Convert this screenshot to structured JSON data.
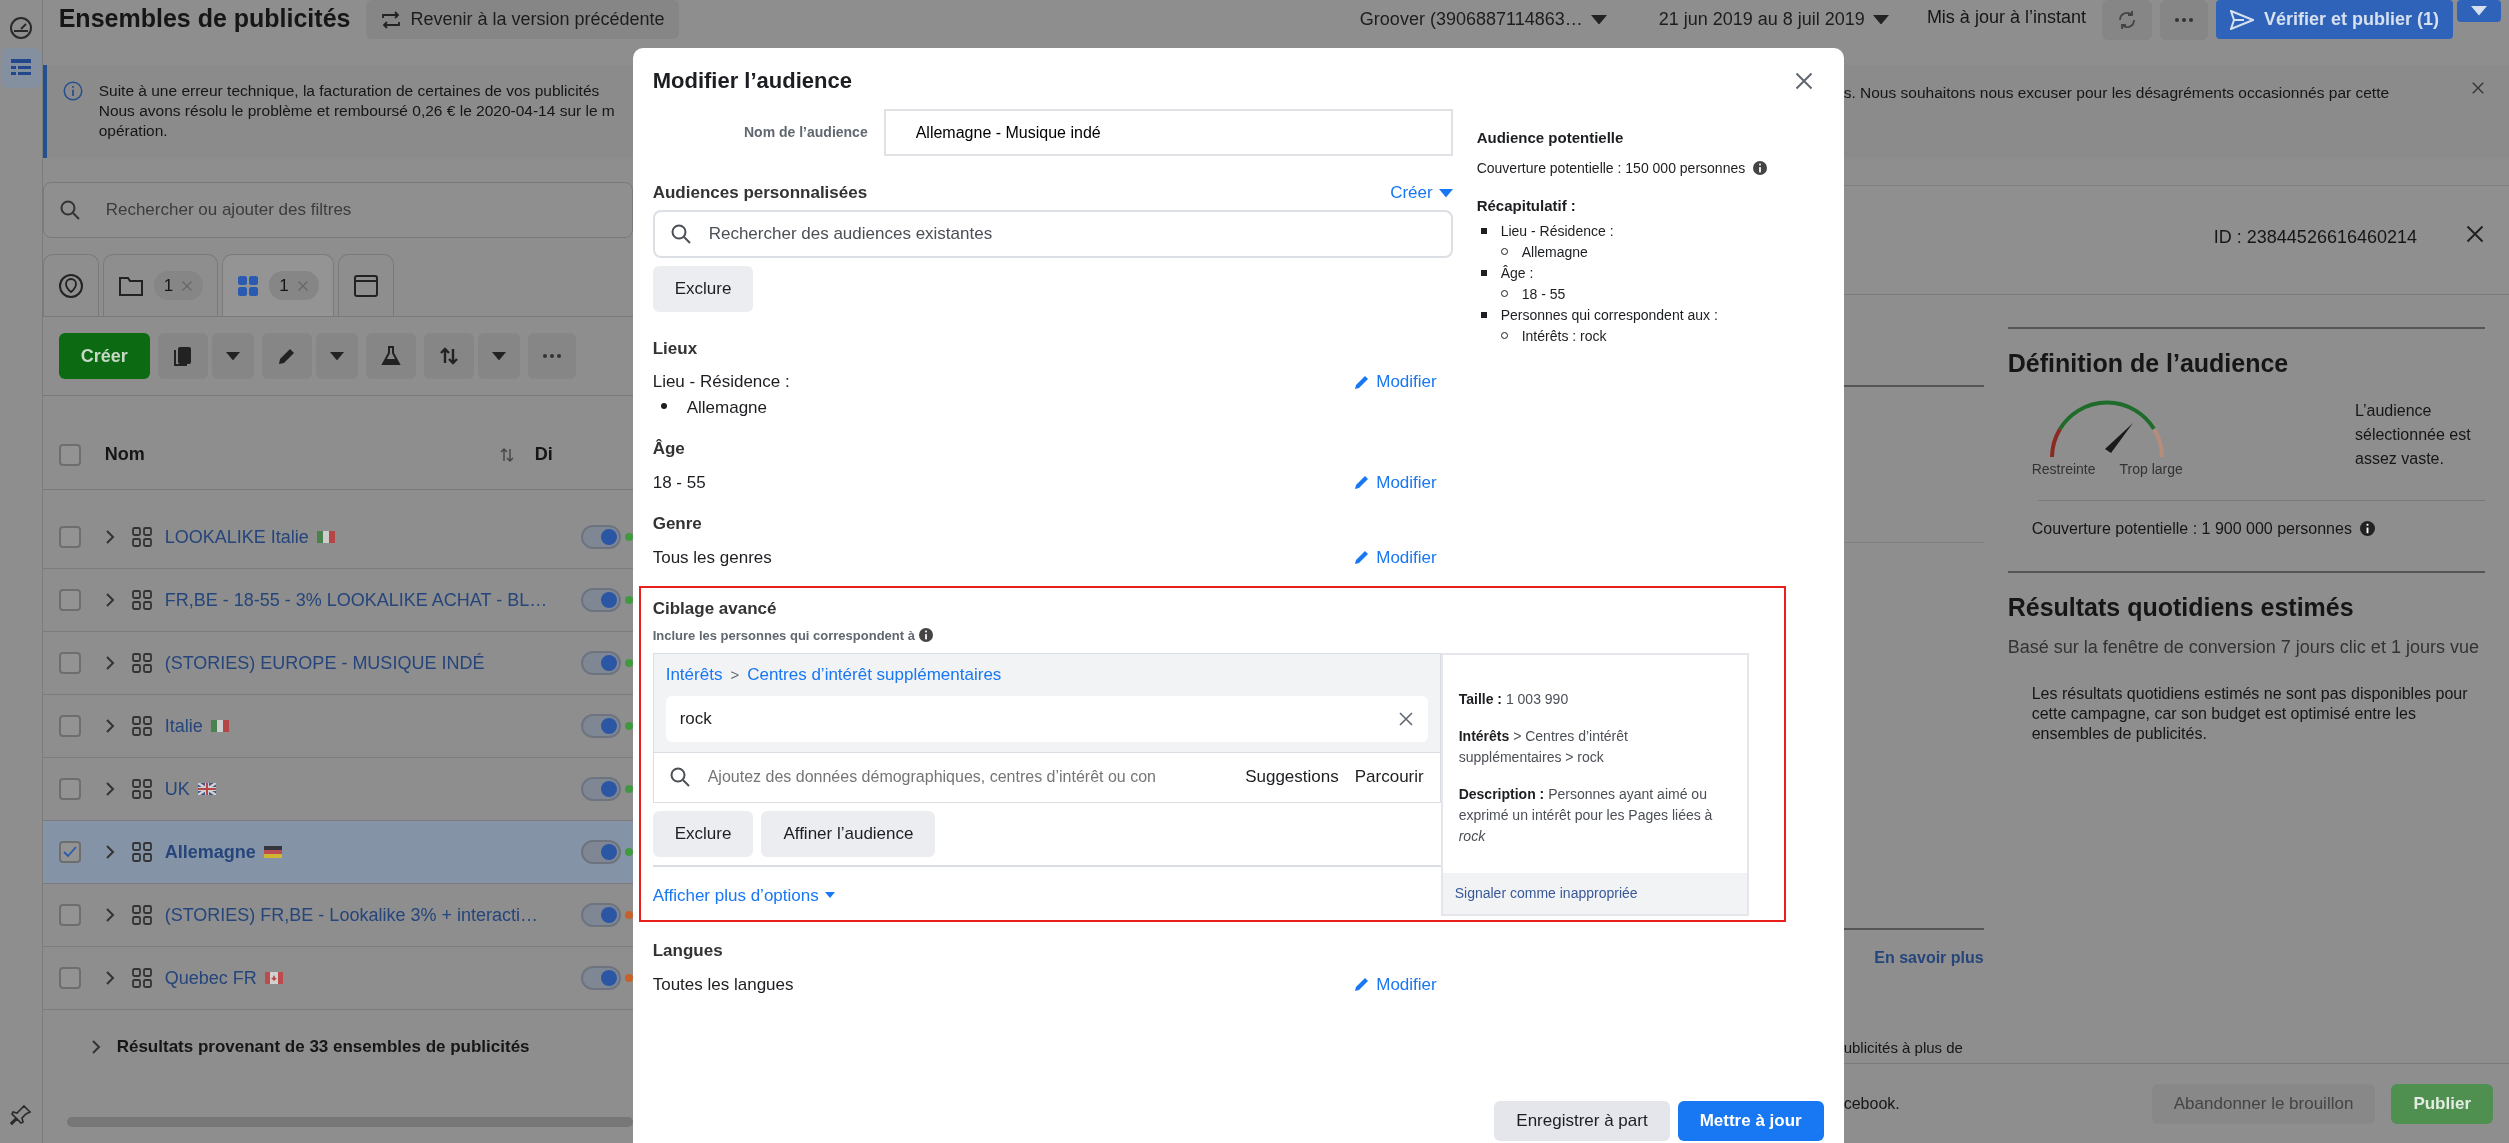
{
  "top_bar": {
    "title": "Ensembles de publicités",
    "revert_button": "Revenir à la version précédente",
    "account": "Groover (3906887114863…",
    "date_range": "21 jun 2019 au 8 juil 2019",
    "status": "Mis à jour à l’instant",
    "publish_button": "Vérifier et publier (1)"
  },
  "sidebar": {
    "items": [
      {
        "kind": "gauge",
        "selected": false
      },
      {
        "kind": "table",
        "selected": true
      },
      {
        "kind": "pin",
        "selected": false
      }
    ]
  },
  "notice": {
    "lines": [
      "Suite à une erreur technique, la facturation de certaines de vos publicités",
      "Nous avons résolu le problème et remboursé 0,26 € le 2020-04-14 sur le m",
      "opération."
    ],
    "continuation": "s. Nous souhaitons nous excuser pour les désagréments occasionnés par cette"
  },
  "filter_search": {
    "placeholder": "Rechercher ou ajouter des filtres"
  },
  "tabs": [
    {
      "kind": "pin",
      "selected": false
    },
    {
      "kind": "folder",
      "count": "1",
      "selected": false
    },
    {
      "kind": "grid",
      "count": "1",
      "selected": true
    },
    {
      "kind": "window",
      "selected": false
    }
  ],
  "toolbar": {
    "create_button": "Créer",
    "tools": [
      {
        "kind": "duplicate",
        "menu": true
      },
      {
        "kind": "edit",
        "menu": true
      },
      {
        "kind": "test",
        "menu": false
      },
      {
        "kind": "sort",
        "menu": true
      },
      {
        "kind": "more",
        "menu": false
      }
    ]
  },
  "table": {
    "select_all": {
      "checked": false
    },
    "columns": [
      "Nom",
      "Di"
    ],
    "rows": [
      {
        "name": "LOOKALIKE Italie",
        "flag": {
          "kind": "it"
        },
        "on": true,
        "selected": false,
        "color": "#3f9a3f"
      },
      {
        "name": "FR,BE - 18-55 - 3% LOOKALIKE ACHAT - BL…",
        "on": true,
        "selected": false,
        "color": "#3f9a3f"
      },
      {
        "name": "(STORIES) EUROPE - MUSIQUE INDÉ",
        "on": true,
        "selected": false,
        "color": "#3f9a3f"
      },
      {
        "name": "Italie",
        "flag": {
          "kind": "it"
        },
        "on": true,
        "selected": false,
        "color": "#3f9a3f"
      },
      {
        "name": "UK",
        "flag": {
          "kind": "gb"
        },
        "on": true,
        "selected": false,
        "color": "#3f9a3f"
      },
      {
        "name": "Allemagne",
        "flag": {
          "kind": "de"
        },
        "on": true,
        "selected": true,
        "color": "#3f9a3f"
      },
      {
        "name": "(STORIES) FR,BE - Lookalike 3% + interacti…",
        "on": true,
        "selected": false,
        "color": "#c8602a"
      },
      {
        "name": "Quebec FR",
        "flag": {
          "kind": "ca"
        },
        "on": true,
        "selected": false,
        "color": "#c8602a"
      }
    ],
    "summary": "Résultats provenant de 33 ensembles de publicités"
  },
  "modal": {
    "title": "Modifier l’audience",
    "name_label": "Nom de l’audience",
    "name_value": "Allemagne - Musique indé",
    "custom_audiences": {
      "heading": "Audiences personnalisées",
      "create_link": "Créer",
      "search_placeholder": "Rechercher des audiences existantes",
      "exclude_button": "Exclure"
    },
    "sections": [
      {
        "heading": "Lieux",
        "lines": [
          "Lieu - Résidence :"
        ],
        "bullets": [
          "Allemagne"
        ],
        "edit_link": "Modifier"
      },
      {
        "heading": "Âge",
        "lines": [
          "18 - 55"
        ],
        "edit_link": "Modifier"
      },
      {
        "heading": "Genre",
        "lines": [
          "Tous les genres"
        ],
        "edit_link": "Modifier"
      }
    ],
    "advanced": {
      "heading": "Ciblage avancé",
      "subheading": "Inclure les personnes qui correspondent à",
      "breadcrumb": [
        "Intérêts",
        "Centres d’intérêt supplémentaires"
      ],
      "separator": ">",
      "tag": "rock",
      "search_placeholder": "Ajoutez des données démographiques, centres d’intérêt ou con",
      "suggestions": "Suggestions",
      "browse": "Parcourir",
      "buttons": [
        "Exclure",
        "Affiner l’audience"
      ],
      "more_options": "Afficher plus d’options",
      "tooltip": {
        "size": "**Taille :** 1 003 990",
        "path": "**Intérêts** > Centres d’intérêt supplémentaires > rock",
        "description": "**Description :** Personnes ayant aimé ou exprimé un intérêt pour les Pages liées à *rock*",
        "report_link": "Signaler comme inappropriée"
      }
    },
    "languages": {
      "heading": "Langues",
      "lines": [
        "Toutes les langues"
      ],
      "edit_link": "Modifier"
    },
    "summary": {
      "heading": "Audience potentielle",
      "coverage": "Couverture potentielle : 150 000 personnes",
      "recap_heading": "Récapitulatif :",
      "items": [
        {
          "label": "Lieu - Résidence :",
          "children": [
            {
              "label": "Allemagne"
            }
          ]
        },
        {
          "label": "Âge :",
          "children": [
            {
              "label": "18 - 55"
            }
          ]
        },
        {
          "label": "Personnes qui correspondent aux :",
          "children": [
            {
              "label": "Intérêts : rock"
            }
          ]
        }
      ]
    },
    "footer_buttons": [
      {
        "label": "Enregistrer à part",
        "kind": "secondary"
      },
      {
        "label": "Mettre à jour",
        "kind": "primary"
      }
    ]
  },
  "right_panel": {
    "id": "ID : 23844526616460214",
    "side_link": "En savoir plus",
    "side_text": "ublicités à plus de",
    "footer_text": "cebook.",
    "definition": {
      "heading": "Définition de l’audience",
      "gauge_labels": [
        "Restreinte",
        "Trop large"
      ],
      "verdict": "L’audience sélectionnée est assez vaste.",
      "coverage": "Couverture potentielle : 1 900 000 personnes"
    },
    "results": {
      "heading": "Résultats quotidiens estimés",
      "subtitle": "Basé sur la fenêtre de conversion 7 jours clic et 1 jours vue",
      "text": "Les résultats quotidiens estimés ne sont pas disponibles pour cette campagne, car son budget est optimisé entre les ensembles de publicités."
    },
    "footer_buttons": [
      {
        "label": "Abandonner le brouillon",
        "kind": "secondary",
        "disabled": true
      },
      {
        "label": "Publier",
        "kind": "success",
        "disabled": true
      }
    ]
  }
}
